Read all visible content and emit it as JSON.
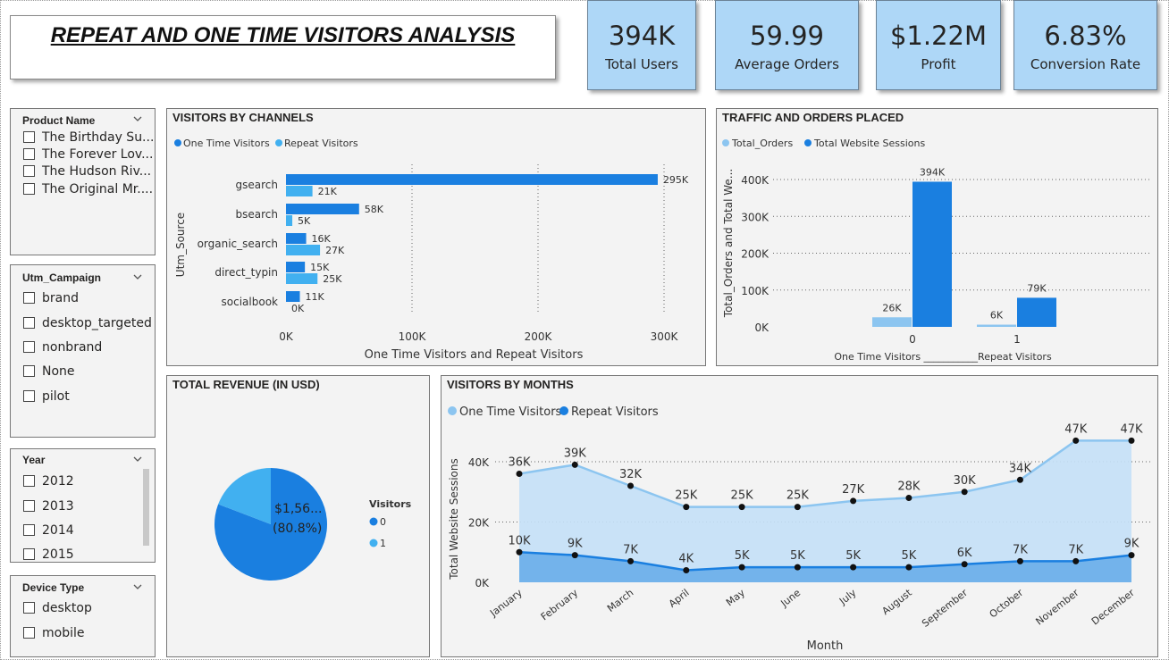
{
  "header": {
    "title": "REPEAT AND ONE TIME VISITORS ANALYSIS"
  },
  "kpis": [
    {
      "value": "394K",
      "label": "Total Users"
    },
    {
      "value": "59.99",
      "label": "Average Orders"
    },
    {
      "value": "$1.22M",
      "label": "Profit"
    },
    {
      "value": "6.83%",
      "label": "Conversion Rate"
    }
  ],
  "colors": {
    "dark_blue": "#1a7fe0",
    "light_blue": "#41b0f0",
    "pale_blue": "#8cc5f0",
    "kpi_bg": "#aed7f7"
  },
  "slicers": {
    "product": {
      "title": "Product Name",
      "items": [
        "The Birthday Su...",
        "The Forever Lov...",
        "The Hudson Riv...",
        "The Original Mr...."
      ]
    },
    "campaign": {
      "title": "Utm_Campaign",
      "items": [
        "brand",
        "desktop_targeted",
        "nonbrand",
        "None",
        "pilot"
      ]
    },
    "year": {
      "title": "Year",
      "items": [
        "2012",
        "2013",
        "2014",
        "2015"
      ]
    },
    "device": {
      "title": "Device Type",
      "items": [
        "desktop",
        "mobile"
      ]
    }
  },
  "chart_data": [
    {
      "id": "channels",
      "type": "bar",
      "orientation": "horizontal",
      "title": "VISITORS BY CHANNELS",
      "ylabel": "Utm_Source",
      "xlabel": "One Time Visitors and Repeat Visitors",
      "categories": [
        "gsearch",
        "bsearch",
        "organic_search",
        "direct_typin",
        "socialbook"
      ],
      "series": [
        {
          "name": "One Time Visitors",
          "values": [
            295000,
            58000,
            16000,
            15000,
            11000
          ],
          "labels": [
            "295K",
            "58K",
            "16K",
            "15K",
            "11K"
          ]
        },
        {
          "name": "Repeat Visitors",
          "values": [
            21000,
            5000,
            27000,
            25000,
            0
          ],
          "labels": [
            "21K",
            "5K",
            "27K",
            "25K",
            "0K"
          ]
        }
      ],
      "xticks": [
        "0K",
        "100K",
        "200K",
        "300K"
      ],
      "xlim": [
        0,
        300000
      ],
      "legend": "top-left"
    },
    {
      "id": "traffic",
      "type": "bar",
      "title": "TRAFFIC AND ORDERS PLACED",
      "ylabel": "Total_Orders and Total We...",
      "xlabel": "One Time Visitors ___________Repeat Visitors",
      "categories": [
        "0",
        "1"
      ],
      "series": [
        {
          "name": "Total_Orders",
          "values": [
            26000,
            6000
          ],
          "labels": [
            "26K",
            "6K"
          ]
        },
        {
          "name": "Total Website Sessions",
          "values": [
            394000,
            79000
          ],
          "labels": [
            "394K",
            "79K"
          ]
        }
      ],
      "yticks": [
        "0K",
        "100K",
        "200K",
        "300K",
        "400K"
      ],
      "ylim": [
        0,
        400000
      ],
      "grid": true,
      "legend": "top-left"
    },
    {
      "id": "revenue",
      "type": "pie",
      "title": "TOTAL REVENUE (IN USD)",
      "legend_title": "Visitors",
      "categories": [
        "0",
        "1"
      ],
      "values": [
        80.8,
        19.2
      ],
      "slice_label": "$1,56...",
      "slice_pct": "(80.8%)",
      "legend": "right"
    },
    {
      "id": "months",
      "type": "area",
      "title": "VISITORS BY MONTHS",
      "ylabel": "Total Website Sessions",
      "xlabel": "Month",
      "categories": [
        "January",
        "February",
        "March",
        "April",
        "May",
        "June",
        "July",
        "August",
        "September",
        "October",
        "November",
        "December"
      ],
      "series": [
        {
          "name": "One Time Visitors",
          "values": [
            36000,
            39000,
            32000,
            25000,
            25000,
            25000,
            27000,
            28000,
            30000,
            34000,
            47000,
            47000
          ],
          "labels": [
            "36K",
            "39K",
            "32K",
            "25K",
            "25K",
            "25K",
            "27K",
            "28K",
            "30K",
            "34K",
            "47K",
            "47K"
          ]
        },
        {
          "name": "Repeat Visitors",
          "values": [
            10000,
            9000,
            7000,
            4000,
            5000,
            5000,
            5000,
            5000,
            6000,
            7000,
            7000,
            9000
          ],
          "labels": [
            "10K",
            "9K",
            "7K",
            "4K",
            "5K",
            "5K",
            "5K",
            "5K",
            "6K",
            "7K",
            "7K",
            "9K"
          ]
        }
      ],
      "yticks": [
        "0K",
        "20K",
        "40K"
      ],
      "ylim": [
        0,
        48000
      ],
      "grid": true,
      "legend": "top-left"
    }
  ]
}
